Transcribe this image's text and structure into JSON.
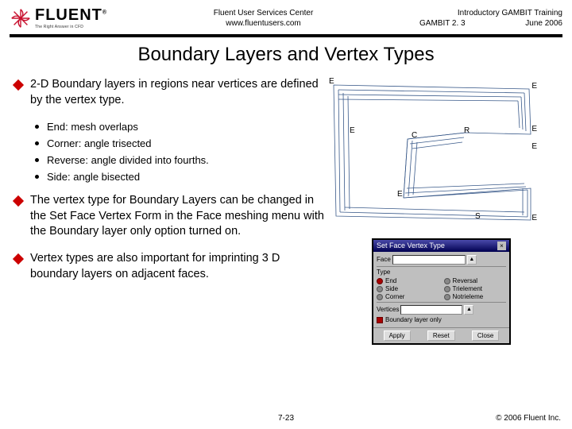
{
  "header": {
    "logo_word": "FLUENT",
    "logo_tagline": "The Right Answer in CFD",
    "center_line1": "Fluent User Services Center",
    "center_line2": "www.fluentusers.com",
    "right_line1": "Introductory GAMBIT Training",
    "right_line2_left": "GAMBIT 2. 3",
    "right_line2_right": "June 2006"
  },
  "title": "Boundary Layers and Vertex Types",
  "bullets": {
    "b1": "2-D Boundary layers in regions near vertices are defined by the vertex type.",
    "sub": {
      "s1": "End: mesh overlaps",
      "s2": "Corner: angle trisected",
      "s3": "Reverse: angle divided into fourths.",
      "s4": "Side: angle bisected"
    },
    "b2": "The vertex type for Boundary Layers can be changed in the Set Face Vertex Form in the Face meshing menu with the Boundary layer only option turned on.",
    "b3": "Vertex types are also important for imprinting 3 D boundary layers on adjacent faces."
  },
  "diagram": {
    "E1": "E",
    "E2": "E",
    "E3": "E",
    "E4": "E",
    "E5": "E",
    "E6": "E",
    "E7": "E",
    "C": "C",
    "R": "R",
    "S": "S"
  },
  "dialog": {
    "title": "Set Face Vertex Type",
    "face_label": "Face",
    "type_label": "Type",
    "opt_end": "End",
    "opt_side": "Side",
    "opt_corner": "Corner",
    "opt_reversal": "Reversal",
    "opt_trielement": "Trielement",
    "opt_notrielement": "Notrieleme",
    "vertices_label": "Vertices",
    "bl_only": "Boundary layer only",
    "btn_apply": "Apply",
    "btn_reset": "Reset",
    "btn_close": "Close"
  },
  "footer": {
    "center": "7-23",
    "right": "© 2006 Fluent Inc."
  }
}
